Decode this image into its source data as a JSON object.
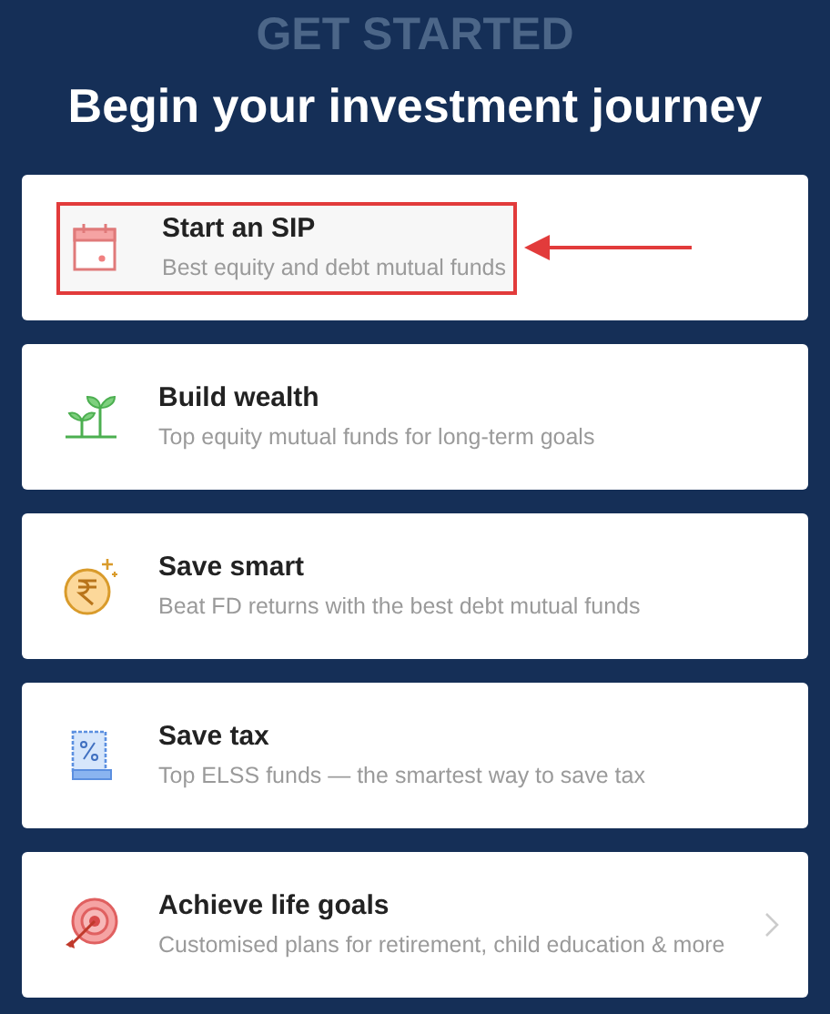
{
  "eyebrow": "GET STARTED",
  "heading": "Begin your investment journey",
  "cards": [
    {
      "kind": "calendar",
      "title": "Start an SIP",
      "subtitle": "Best equity and debt mutual funds",
      "highlighted": true,
      "chevron": false
    },
    {
      "kind": "sprout",
      "title": "Build wealth",
      "subtitle": "Top equity mutual funds for long-term goals",
      "highlighted": false,
      "chevron": false
    },
    {
      "kind": "rupee",
      "title": "Save smart",
      "subtitle": "Beat FD returns with the best debt mutual funds",
      "highlighted": false,
      "chevron": false
    },
    {
      "kind": "receipt",
      "title": "Save tax",
      "subtitle": "Top ELSS funds — the smartest way to save tax",
      "highlighted": false,
      "chevron": false
    },
    {
      "kind": "target",
      "title": "Achieve life goals",
      "subtitle": "Customised plans for retirement, child education & more",
      "highlighted": false,
      "chevron": true
    }
  ]
}
